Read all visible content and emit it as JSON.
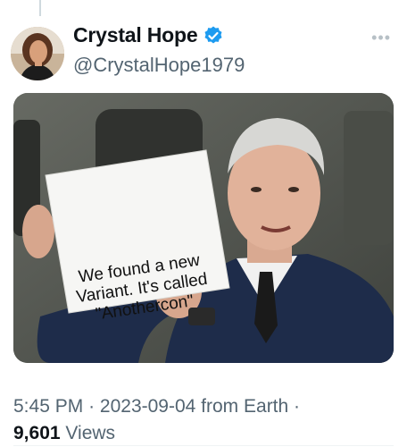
{
  "author": {
    "display_name": "Crystal Hope",
    "handle": "@CrystalHope1979",
    "verified_icon": "verified-badge-icon",
    "avatar_icon": "profile-photo"
  },
  "more_icon": "ellipsis-icon",
  "media": {
    "sign_text": "We found a new Variant. It's called \"Anothercon\""
  },
  "meta": {
    "time": "5:45 PM",
    "date": "2023-09-04",
    "source": "from Earth",
    "separator": "·",
    "views_count": "9,601",
    "views_label": "Views"
  },
  "colors": {
    "accent": "#1d9bf0",
    "secondary_text": "#536471"
  }
}
